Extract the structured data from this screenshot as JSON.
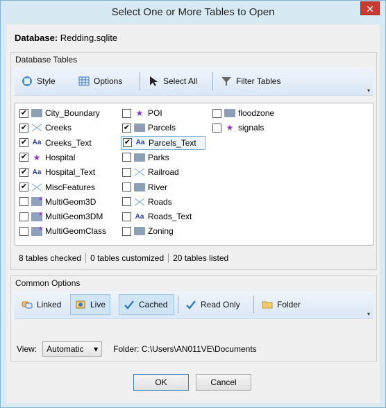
{
  "window": {
    "title": "Select One or More Tables to Open",
    "close_glyph": "✕"
  },
  "database": {
    "label": "Database:",
    "name": "Redding.sqlite"
  },
  "tables_group": {
    "title": "Database Tables",
    "toolbar": {
      "style": "Style",
      "options": "Options",
      "select_all": "Select All",
      "filter": "Filter Tables"
    },
    "items": [
      {
        "label": "City_Boundary",
        "checked": true,
        "icon": "folder-icon"
      },
      {
        "label": "Creeks",
        "checked": true,
        "icon": "line-icon"
      },
      {
        "label": "Creeks_Text",
        "checked": true,
        "icon": "text-icon"
      },
      {
        "label": "Hospital",
        "checked": true,
        "icon": "star-icon"
      },
      {
        "label": "Hospital_Text",
        "checked": true,
        "icon": "text-icon"
      },
      {
        "label": "MiscFeatures",
        "checked": true,
        "icon": "line-icon"
      },
      {
        "label": "MultiGeom3D",
        "checked": false,
        "icon": "multigeom-icon"
      },
      {
        "label": "MultiGeom3DM",
        "checked": false,
        "icon": "multigeom-icon"
      },
      {
        "label": "MultiGeomClass",
        "checked": false,
        "icon": "multigeom-icon"
      },
      {
        "label": "POI",
        "checked": false,
        "icon": "star-icon"
      },
      {
        "label": "Parcels",
        "checked": true,
        "icon": "folder-icon"
      },
      {
        "label": "Parcels_Text",
        "checked": true,
        "icon": "text-icon"
      },
      {
        "label": "Parks",
        "checked": false,
        "icon": "folder-icon"
      },
      {
        "label": "Railroad",
        "checked": false,
        "icon": "line-icon"
      },
      {
        "label": "River",
        "checked": false,
        "icon": "folder-icon"
      },
      {
        "label": "Roads",
        "checked": false,
        "icon": "line-icon"
      },
      {
        "label": "Roads_Text",
        "checked": false,
        "icon": "text-icon"
      },
      {
        "label": "Zoning",
        "checked": false,
        "icon": "folder-icon"
      },
      {
        "label": "floodzone",
        "checked": false,
        "icon": "folder-icon"
      },
      {
        "label": "signals",
        "checked": false,
        "icon": "star-icon"
      }
    ],
    "status": {
      "checked": "8 tables checked",
      "customized": "0 tables customized",
      "listed": "20 tables listed"
    }
  },
  "common_options": {
    "title": "Common Options",
    "toolbar": {
      "linked": "Linked",
      "live": "Live",
      "cached": "Cached",
      "read_only": "Read Only",
      "folder": "Folder"
    },
    "view_label": "View:",
    "view_value": "Automatic",
    "folder_text": "Folder: C:\\Users\\AN011VE\\Documents"
  },
  "buttons": {
    "ok": "OK",
    "cancel": "Cancel"
  },
  "colors": {
    "accent": "#2f7fc1",
    "title_bg": "#d7eaf4",
    "check_blue": "#1e73be"
  }
}
